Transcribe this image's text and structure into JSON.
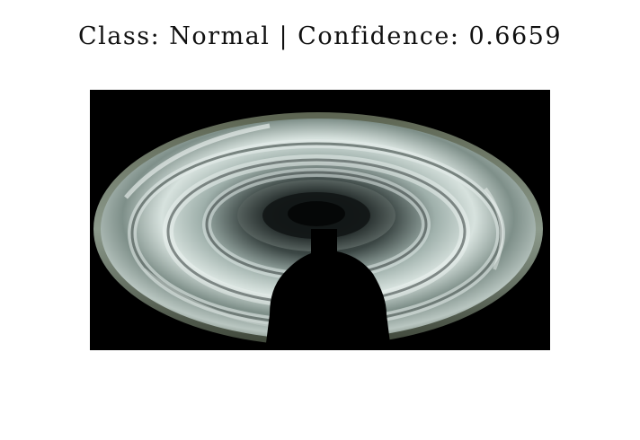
{
  "title": {
    "prefix": "Class: ",
    "class_label": "Normal",
    "separator": " | ",
    "confidence_prefix": "Confidence: ",
    "confidence_value": "0.6659"
  },
  "image": {
    "subject": "glass disc insulator",
    "background_color": "#000000"
  }
}
